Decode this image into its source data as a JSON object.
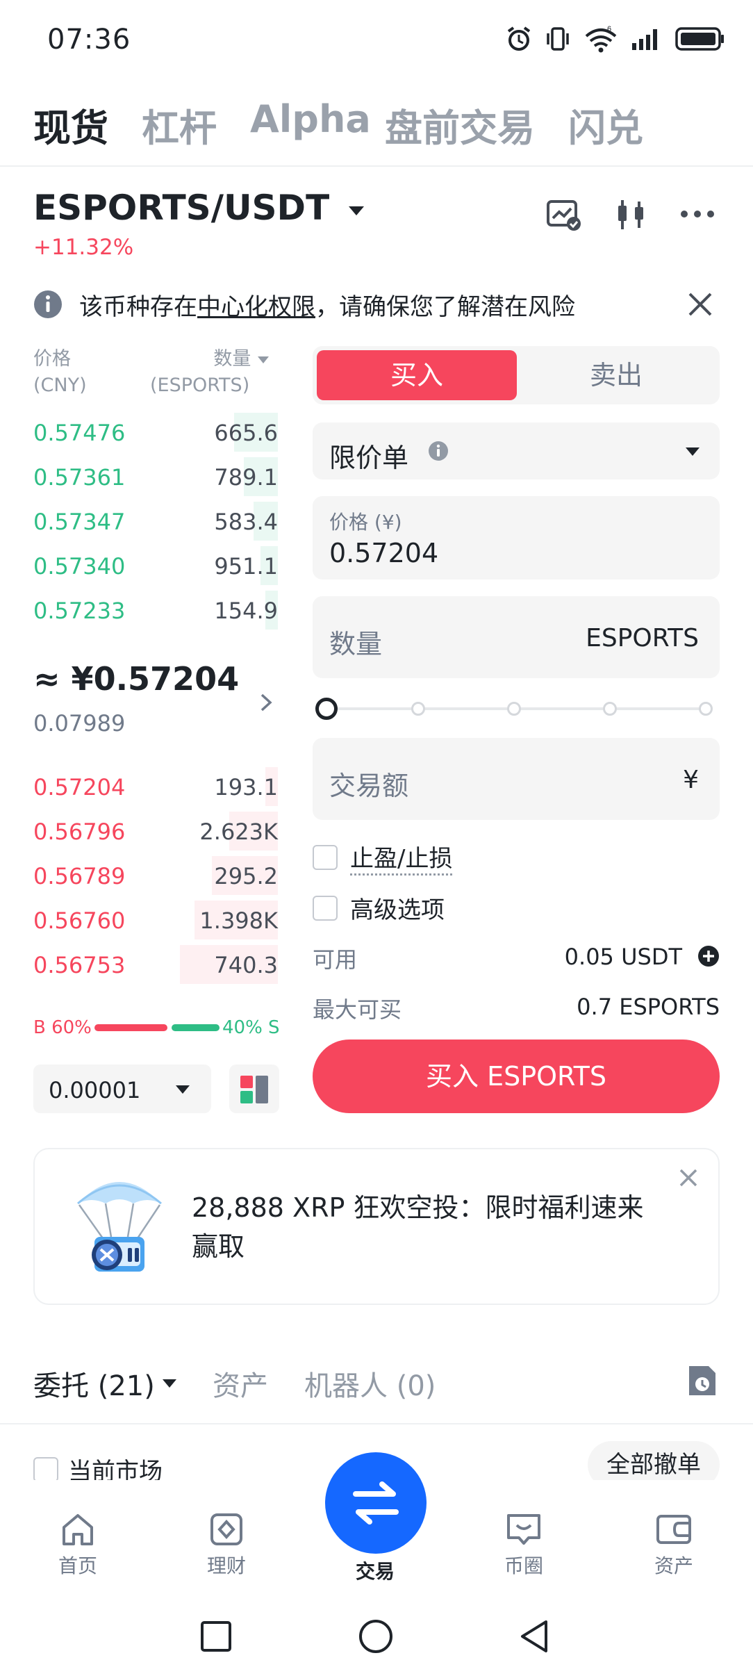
{
  "status": {
    "time": "07:36"
  },
  "top_tabs": [
    {
      "label": "现货",
      "active": true
    },
    {
      "label": "杠杆",
      "active": false
    },
    {
      "label": "Alpha",
      "active": false
    },
    {
      "label": "盘前交易",
      "active": false
    },
    {
      "label": "闪兑",
      "active": false
    }
  ],
  "pair": {
    "name": "ESPORTS/USDT",
    "change": "+11.32%"
  },
  "notice": {
    "pre": "该币种存在",
    "link": "中心化权限",
    "post": "，请确保您了解潜在风险"
  },
  "orderbook": {
    "price_header": "价格",
    "price_unit": "(CNY)",
    "qty_header": "数量",
    "qty_unit": "(ESPORTS)",
    "asks": [
      {
        "price": "0.57476",
        "qty": "665.6",
        "depth": 0.18
      },
      {
        "price": "0.57361",
        "qty": "789.1",
        "depth": 0.14
      },
      {
        "price": "0.57347",
        "qty": "583.4",
        "depth": 0.1
      },
      {
        "price": "0.57340",
        "qty": "951.1",
        "depth": 0.07
      },
      {
        "price": "0.57233",
        "qty": "154.9",
        "depth": 0.05
      }
    ],
    "last_price": "≈ ¥0.57204",
    "last_price_usd": "0.07989",
    "bids": [
      {
        "price": "0.57204",
        "qty": "193.1",
        "depth": 0.05
      },
      {
        "price": "0.56796",
        "qty": "2.623K",
        "depth": 0.2
      },
      {
        "price": "0.56789",
        "qty": "295.2",
        "depth": 0.27
      },
      {
        "price": "0.56760",
        "qty": "1.398K",
        "depth": 0.34
      },
      {
        "price": "0.56753",
        "qty": "740.3",
        "depth": 0.4
      }
    ],
    "buy_ratio": "B 60%",
    "sell_ratio": "40% S",
    "buy_fraction": 0.6,
    "precision": "0.00001"
  },
  "form": {
    "buy_tab": "买入",
    "sell_tab": "卖出",
    "order_type": "限价单",
    "price_label": "价格 (¥)",
    "price_value": "0.57204",
    "qty_label": "数量",
    "qty_unit": "ESPORTS",
    "amount_label": "交易额",
    "amount_unit": "¥",
    "tpsl_label": "止盈/止损",
    "advanced_label": "高级选项",
    "available_label": "可用",
    "available_value": "0.05 USDT",
    "max_buy_label": "最大可买",
    "max_buy_value": "0.7 ESPORTS",
    "submit_label": "买入 ESPORTS",
    "slider_fraction": 0
  },
  "promo": {
    "text": "28,888 XRP 狂欢空投：限时福利速来赢取"
  },
  "orders": {
    "tabs": [
      "委托 (21)",
      "资产",
      "机器人 (0)"
    ],
    "current_market": "当前市场",
    "cancel_all": "全部撤单"
  },
  "bottom_nav": [
    {
      "label": "首页",
      "icon": "home-icon"
    },
    {
      "label": "理财",
      "icon": "earn-icon"
    },
    {
      "label": "交易",
      "icon": "trade-icon"
    },
    {
      "label": "币圈",
      "icon": "square-icon"
    },
    {
      "label": "资产",
      "icon": "wallet-icon"
    }
  ],
  "colors": {
    "buy": "#f6465d",
    "sell": "#2ebd85",
    "trade_button": "#1568ff"
  }
}
